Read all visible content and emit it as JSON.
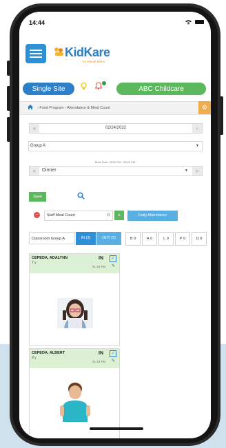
{
  "status_bar": {
    "time": "14:44",
    "wifi_icon": "wifi-icon",
    "battery_icon": "battery-icon"
  },
  "header": {
    "menu_icon": "hamburger-icon",
    "logo": {
      "brand": "KidKare",
      "sub": "by Minute Menu"
    },
    "site_button": "Single Site",
    "center_button": "ABC Childcare",
    "colors": {
      "site": "#2d7fc7",
      "center": "#5cb85c",
      "menu": "#2d8fd5"
    }
  },
  "breadcrumb": {
    "home_icon": "home-icon",
    "items": [
      "Food Program",
      "Attendance & Meal Count"
    ],
    "text": "› Food Program › Attendance & Meal Count"
  },
  "date_nav": {
    "prev": "«",
    "date": "02/24/2022",
    "next": "›"
  },
  "group_select": {
    "value": "Group A"
  },
  "meal_time": "Meal Time: 03:00 PM - 05:00 PM",
  "meal_select": {
    "prev": "«",
    "value": "Dinner",
    "next": "»"
  },
  "actions": {
    "save": "Save"
  },
  "staff": {
    "label": "Staff Meal Count",
    "value": "0",
    "minus": "−",
    "plus": "+",
    "daily_attendance": "Daily Attendance"
  },
  "filter": {
    "classroom": "Classroom Group A",
    "in_label": "IN (3)",
    "out_label": "OUT (2)",
    "counts": [
      {
        "key": "B",
        "value": "0"
      },
      {
        "key": "A",
        "value": "0"
      },
      {
        "key": "L",
        "value": "0"
      },
      {
        "key": "P",
        "value": "0"
      },
      {
        "key": "D",
        "value": "0"
      }
    ]
  },
  "children": [
    {
      "name": "CEPEDA, ADALYNN",
      "age": "7 y",
      "status": "IN",
      "time": "01:43 PM"
    },
    {
      "name": "CEPEDA, ALBERT",
      "age": "9 y",
      "status": "IN",
      "time": "01:43 PM"
    }
  ]
}
